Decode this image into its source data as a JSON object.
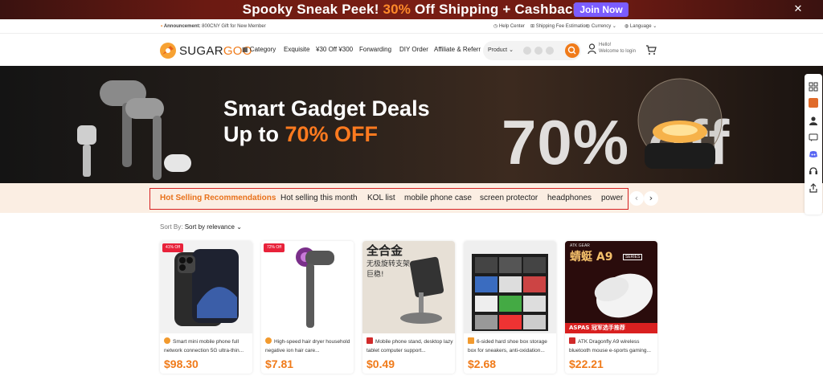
{
  "promo": {
    "text_before": "Spooky Sneak Peek! ",
    "text_highlight": "30%",
    "text_after": " Off Shipping + Cashback",
    "button": "Join Now"
  },
  "topbar": {
    "announcement_label": "Announcement:",
    "announcement_text": "800CNY Gift for New Member",
    "help": "Help Center",
    "shipping": "Shipping Fee Estimation",
    "currency": "Currency",
    "language": "Language"
  },
  "header": {
    "logo_a": "SUGAR",
    "logo_b": "GOO",
    "nav": [
      "Category",
      "Exquisite",
      "¥30 Off ¥300",
      "Forwarding",
      "DIY Order",
      "Affiliate & Referr"
    ],
    "search_scope": "Product",
    "user_hello": "Hello!",
    "user_login": "Welcome to login"
  },
  "banner": {
    "line1": "Smart Gadget Deals",
    "line2_prefix": "Up to ",
    "line2_highlight": "70% OFF",
    "big_text": "70% off"
  },
  "tabs": [
    "Hot Selling Recommendations",
    "Hot selling this month",
    "KOL list",
    "mobile phone case",
    "screen protector",
    "headphones",
    "power"
  ],
  "sort": {
    "label": "Sort By:",
    "value": "Sort by relevance"
  },
  "products": [
    {
      "badge": "41% Off",
      "desc": "Smart mini mobile phone full network connection 5G ultra-thin...",
      "price": "$98.30"
    },
    {
      "badge": "72% Off",
      "desc": "High-speed hair dryer household negative ion hair care...",
      "price": "$7.81"
    },
    {
      "badge": "",
      "desc": "Mobile phone stand, desktop lazy tablet computer support...",
      "price": "$0.49",
      "overlay_cn": "全合金",
      "overlay_cn2": "无极旋转支架",
      "overlay_cn3": "巨稳!"
    },
    {
      "badge": "",
      "desc": "6-sided hard shoe box storage box for sneakers, anti-oxidation...",
      "price": "$2.68"
    },
    {
      "badge": "",
      "desc": "ATK Dragonfly A9 wireless bluetooth mouse e-sports gaming...",
      "price": "$22.21",
      "overlay_cn": "蜻蜓",
      "overlay_model": "A9",
      "overlay_tag": "SERIES",
      "overlay_brand": "ATK GEAR",
      "overlay_strip": "ASPAS 冠军选手推荐"
    }
  ],
  "colors": {
    "accent": "#f07b1a",
    "promo_button": "#7b5cff",
    "badge": "#e8223a",
    "highlight_border": "#d62020"
  }
}
